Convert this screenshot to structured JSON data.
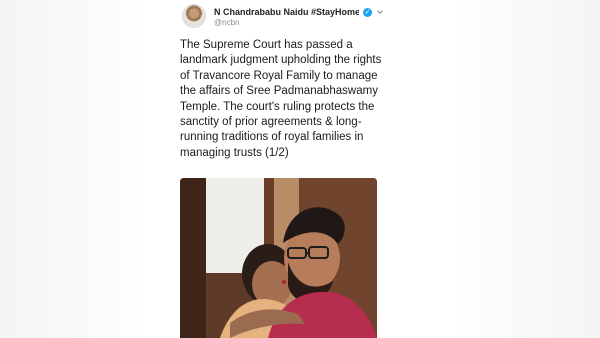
{
  "tweet": {
    "author_name": "N Chandrababu Naidu #StayHomeSa...",
    "handle": "@ncbn",
    "text": "The Supreme Court has passed a landmark judgment upholding the rights of Travancore Royal Family to manage the affairs of Sree Padmanabhaswamy Temple. The court's ruling protects the sanctity of prior agreements & long-running traditions of royal families in managing trusts (1/2)"
  },
  "icons": {
    "verified": "verified-icon",
    "chevron": "chevron-down-icon"
  },
  "colors": {
    "verified_blue": "#1da1f2",
    "text": "#1b1b1b",
    "handle_gray": "#8a8f94"
  }
}
